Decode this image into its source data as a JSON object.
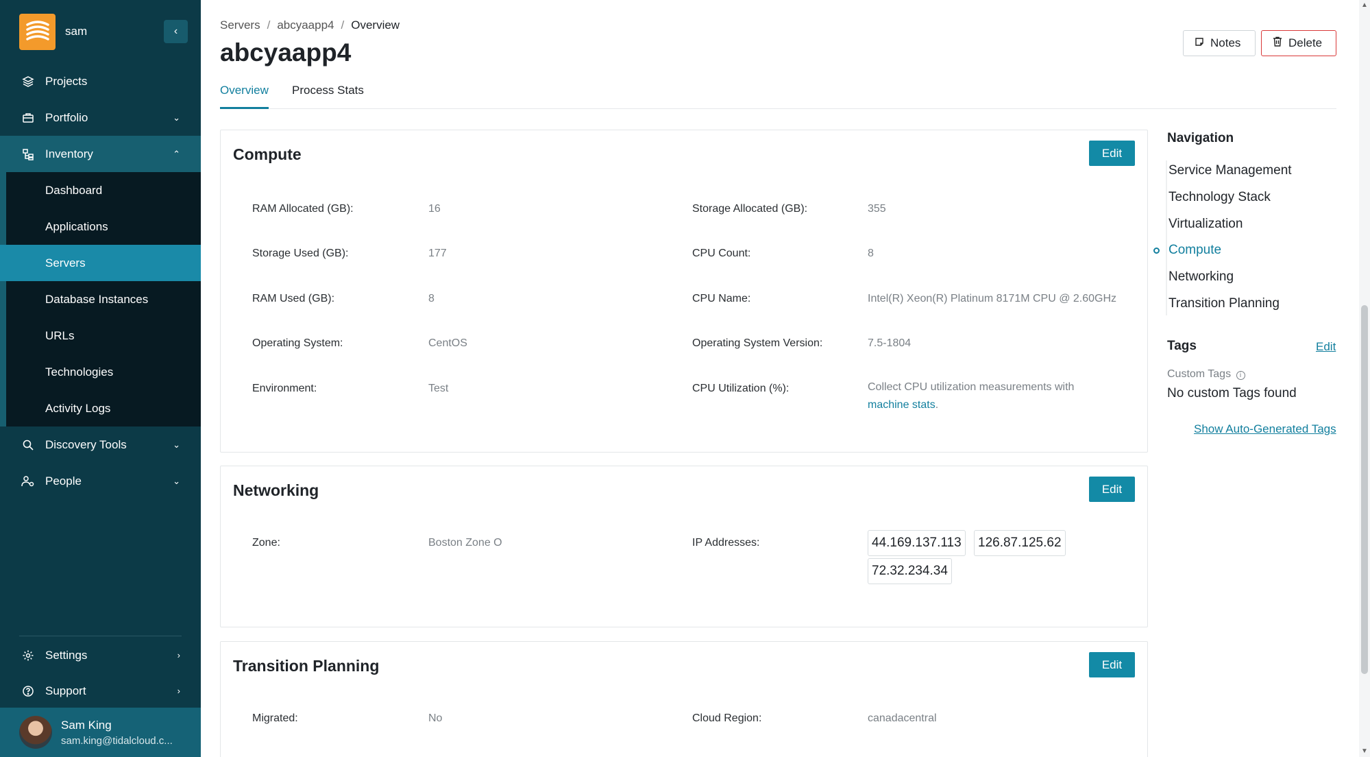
{
  "sidebar": {
    "org_name": "sam",
    "items": [
      {
        "label": "Projects",
        "icon": "layers-icon"
      },
      {
        "label": "Portfolio",
        "icon": "briefcase-icon"
      },
      {
        "label": "Inventory",
        "icon": "hierarchy-icon"
      },
      {
        "label": "Discovery Tools",
        "icon": "search-icon"
      },
      {
        "label": "People",
        "icon": "people-icon"
      }
    ],
    "inventory_sub": [
      "Dashboard",
      "Applications",
      "Servers",
      "Database Instances",
      "URLs",
      "Technologies",
      "Activity Logs"
    ],
    "active_sub": "Servers",
    "settings_label": "Settings",
    "support_label": "Support",
    "user": {
      "name": "Sam King",
      "email": "sam.king@tidalcloud.c..."
    }
  },
  "breadcrumb": [
    "Servers",
    "abcyaapp4",
    "Overview"
  ],
  "page_title": "abcyaapp4",
  "header_buttons": {
    "notes": "Notes",
    "delete": "Delete"
  },
  "tabs": [
    "Overview",
    "Process Stats"
  ],
  "edit_label": "Edit",
  "compute": {
    "title": "Compute",
    "fields": [
      {
        "label": "RAM Allocated (GB):",
        "value": "16"
      },
      {
        "label": "Storage Allocated (GB):",
        "value": "355"
      },
      {
        "label": "Storage Used (GB):",
        "value": "177"
      },
      {
        "label": "CPU Count:",
        "value": "8"
      },
      {
        "label": "RAM Used (GB):",
        "value": "8"
      },
      {
        "label": "CPU Name:",
        "value": "Intel(R) Xeon(R) Platinum 8171M CPU @ 2.60GHz"
      },
      {
        "label": "Operating System:",
        "value": "CentOS"
      },
      {
        "label": "Operating System Version:",
        "value": "7.5-1804"
      },
      {
        "label": "Environment:",
        "value": "Test"
      },
      {
        "label": "CPU Utilization (%):",
        "value": "Collect CPU utilization measurements with",
        "link": "machine stats",
        "suffix": "."
      }
    ]
  },
  "networking": {
    "title": "Networking",
    "zone_label": "Zone:",
    "zone_value": "Boston Zone O",
    "ip_label": "IP Addresses:",
    "ips": [
      "44.169.137.113",
      "126.87.125.62",
      "72.32.234.34"
    ]
  },
  "transition": {
    "title": "Transition Planning",
    "migrated_label": "Migrated:",
    "migrated_value": "No",
    "region_label": "Cloud Region:",
    "region_value": "canadacentral"
  },
  "right_panel": {
    "nav_title": "Navigation",
    "nav_items": [
      "Service Management",
      "Technology Stack",
      "Virtualization",
      "Compute",
      "Networking",
      "Transition Planning"
    ],
    "active_nav": "Compute",
    "tags_title": "Tags",
    "tags_edit": "Edit",
    "custom_tags_label": "Custom Tags",
    "no_tags": "No custom Tags found",
    "show_auto": "Show Auto-Generated Tags"
  },
  "colors": {
    "sidebar_bg": "#0c3a47",
    "accent": "#138aa6",
    "active_sub_bg": "#1a8aa8",
    "delete_border": "#d93838"
  }
}
